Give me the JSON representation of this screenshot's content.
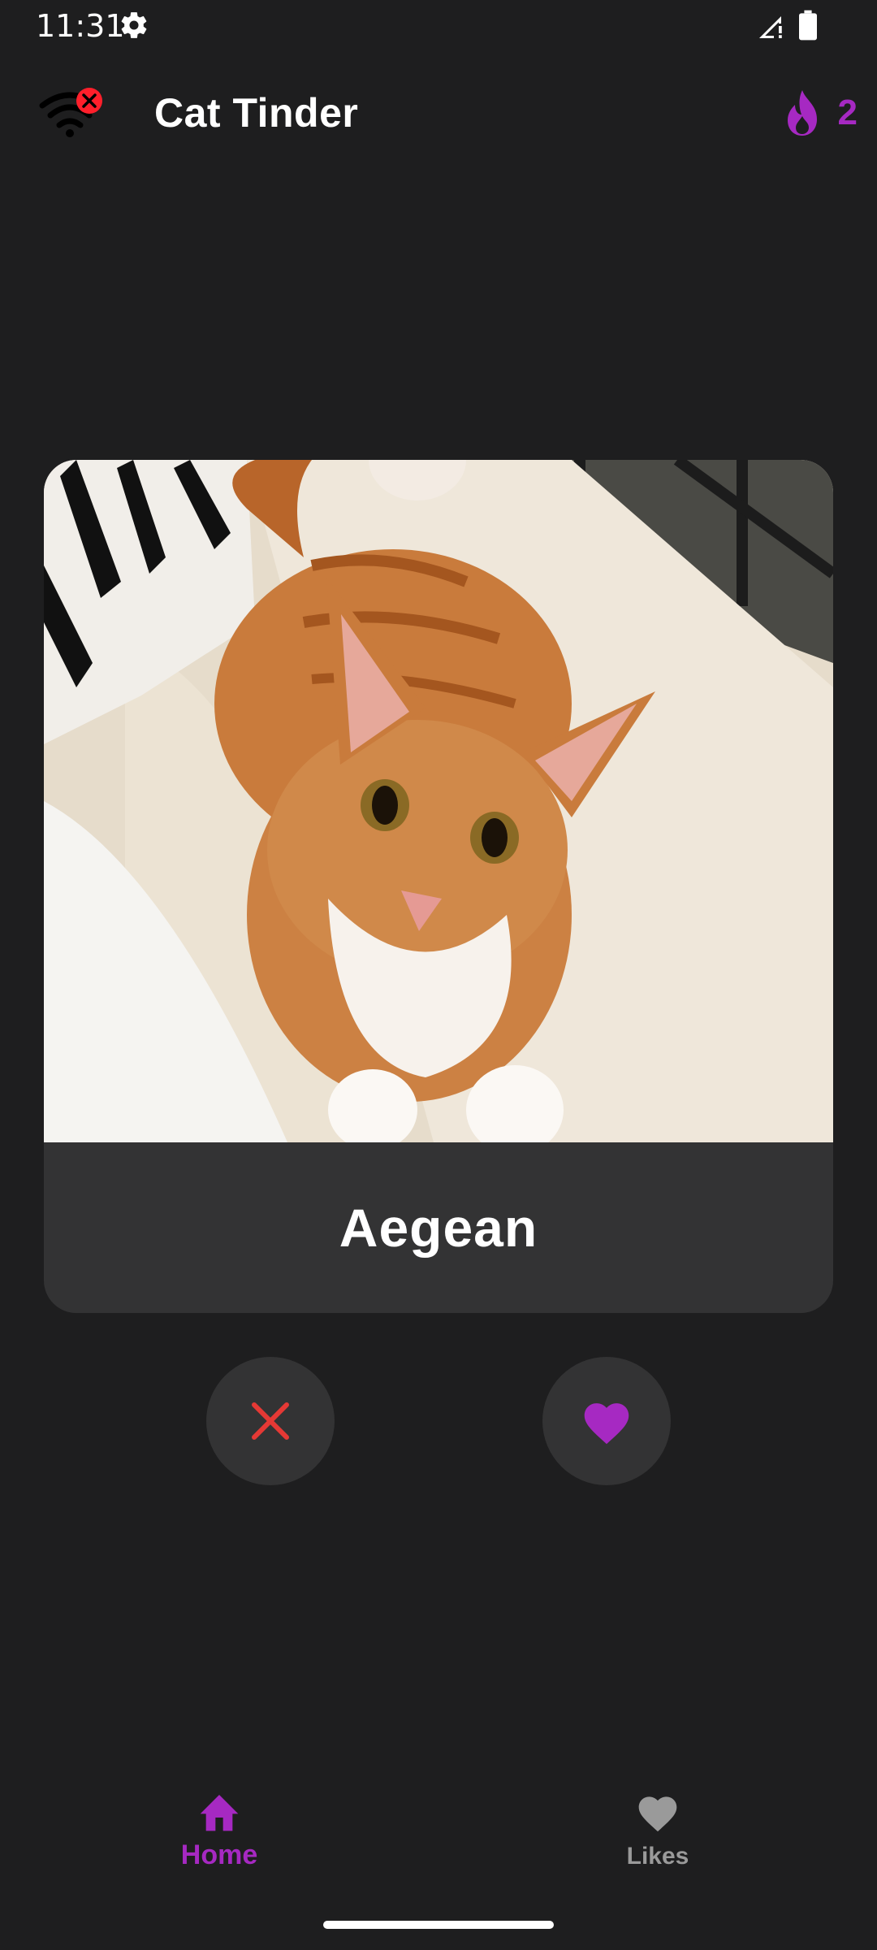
{
  "status_bar": {
    "time": "11:31",
    "icons": [
      "gear-icon",
      "signal-icon",
      "battery-icon"
    ]
  },
  "app_bar": {
    "title": "Cat Tinder",
    "connectivity_icon": "wifi-off-icon",
    "streak_icon": "flame-icon",
    "streak_count": "2"
  },
  "card": {
    "image": "orange tabby kitten on a cream pillow",
    "name": "Aegean"
  },
  "actions": {
    "dislike_icon": "close-icon",
    "like_icon": "heart-icon"
  },
  "nav": {
    "items": [
      {
        "label": "Home",
        "icon": "home-icon",
        "active": true
      },
      {
        "label": "Likes",
        "icon": "heart-icon",
        "active": false
      }
    ]
  },
  "colors": {
    "background": "#1e1e1f",
    "surface": "#333334",
    "accent": "#a629c2",
    "dislike": "#e53935",
    "inactive": "#9a9a9a"
  }
}
